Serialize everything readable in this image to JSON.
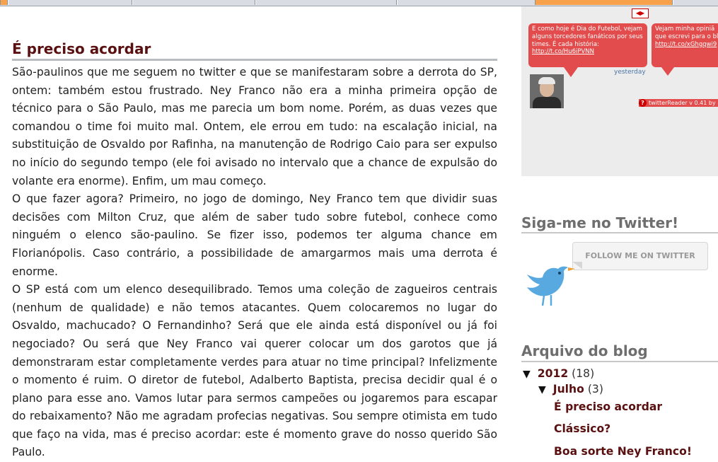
{
  "post": {
    "title": "É preciso acordar",
    "paragraphs": [
      "São-paulinos que me seguem no twitter e que se manifestaram sobre a derrota do SP, ontem: também estou frustrado. Ney Franco não era a minha primeira opção de técnico para o São Paulo, mas me parecia um bom nome. Porém, as duas vezes que comandou o time foi muito mal. Ontem, ele errou em tudo: na escalação inicial, na substituição de Osvaldo por Rafinha, na manutenção de Rodrigo Caio para ser expulso no início do segundo tempo (ele foi avisado no intervalo que a chance de expulsão do volante era enorme). Enfim, um mau começo.",
      "O que fazer agora? Primeiro, no jogo de domingo, Ney Franco tem que dividir suas decisões com Milton Cruz, que além de saber tudo sobre futebol, conhece como ninguém o elenco são-paulino. Se fizer isso, podemos ter alguma chance em Florianópolis. Caso contrário, a possibilidade de amargarmos mais uma derrota é enorme.",
      "O SP está com um elenco desequilibrado. Temos uma coleção de zagueiros centrais (nenhum de qualidade) e não temos atacantes. Quem colocaremos no lugar do Osvaldo, machucado? O Fernandinho? Será que ele ainda está disponível ou já foi negociado? Ou será que Ney Franco vai querer colocar um dos garotos que já demonstraram estar completamente verdes para atuar no time principal? Infelizmente o momento é ruim. O diretor de futebol, Adalberto Baptista, precisa decidir qual é o plano para esse ano. Vamos lutar para sermos campeões ou jogaremos para escapar do rebaixamento? Não me agradam profecias negativas. Sou sempre otimista em tudo que faço na vida, mas é preciso acordar: este é momento grave do nosso querido São Paulo."
    ]
  },
  "twitter_widget": {
    "tweet1_text": "E como hoje é  Dia do Futebol, vejam alguns torcedores fanáticos por seus times. É cada história: ",
    "tweet1_link": "http://t.co/Hu6iPVNN",
    "tweet2_text": "Vejam minha opiniã que escrevi para o bl",
    "tweet2_link": "http://t.co/xGhgqwi9",
    "timestamp": "yesterday",
    "reader_label": "twitterReader v 0.41 by",
    "help_glyph": "?",
    "nav_arrows": "◀▶"
  },
  "follow_section": {
    "title": "Siga-me no Twitter!",
    "badge_text": "FOLLOW ME ON TWITTER",
    "bird_icon": "twitter-bird-icon"
  },
  "archive": {
    "title": "Arquivo do blog",
    "year_toggle": "▼",
    "year": "2012",
    "year_count": "(18)",
    "month_toggle": "▼",
    "month": "Julho",
    "month_count": "(3)",
    "posts": [
      "É preciso acordar",
      "Clássico?",
      "Boa sorte Ney Franco!"
    ]
  },
  "colors": {
    "title_maroon": "#5a1010",
    "widget_red": "#e24c4c",
    "sidebar_gray": "#ececec",
    "twitter_blue": "#58a9e0"
  }
}
